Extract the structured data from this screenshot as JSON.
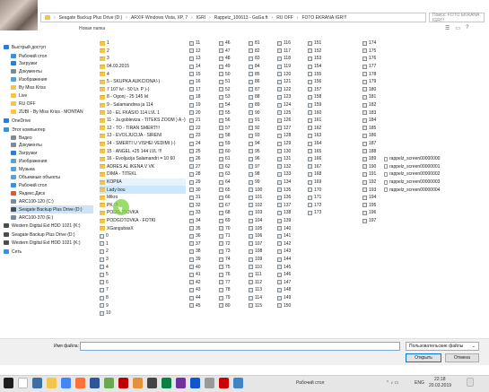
{
  "address": {
    "segments": [
      "Seagate Backup Plus Drive (D:)",
      "ARXIF Windows Vista, XP, 7",
      "IGRI",
      "Rappelz_100613 - GaGa ft",
      "RU OFF",
      "FOTO EKRANA IGR!!!"
    ]
  },
  "search": {
    "placeholder": "Поиск: FOTO EKRANA IGR!!!"
  },
  "toolbar": {
    "new_folder": "Новая папка"
  },
  "nav": [
    {
      "label": "Быстрый доступ",
      "icon": "star-icon",
      "color": "#2d7bd6"
    },
    {
      "label": "Рабочий стол",
      "icon": "desktop-icon",
      "color": "#3b8fdc"
    },
    {
      "label": "Загрузки",
      "icon": "download-icon",
      "color": "#2d7bd6"
    },
    {
      "label": "Документы",
      "icon": "document-icon",
      "color": "#7c8a99"
    },
    {
      "label": "Изображения",
      "icon": "image-icon",
      "color": "#5aa0d8"
    },
    {
      "label": "By Miss Kriss",
      "icon": "folder-icon",
      "color": "#f3c64b"
    },
    {
      "label": "Live",
      "icon": "folder-icon",
      "color": "#f3c64b"
    },
    {
      "label": "RU OFF",
      "icon": "folder-icon",
      "color": "#f3c64b"
    },
    {
      "label": "ZUBI - By Miss Kriss - MONTAN",
      "icon": "folder-icon",
      "color": "#f3c64b"
    },
    {
      "label": "OneDrive",
      "icon": "cloud-icon",
      "color": "#2d7bd6"
    },
    {
      "label": "Этот компьютер",
      "icon": "computer-icon",
      "color": "#3b8fdc"
    },
    {
      "label": "Видео",
      "icon": "video-icon",
      "color": "#7c8a99"
    },
    {
      "label": "Документы",
      "icon": "document-icon",
      "color": "#7c8a99"
    },
    {
      "label": "Загрузки",
      "icon": "download-icon",
      "color": "#2d7bd6"
    },
    {
      "label": "Изображения",
      "icon": "image-icon",
      "color": "#5aa0d8"
    },
    {
      "label": "Музыка",
      "icon": "music-icon",
      "color": "#5aa0d8"
    },
    {
      "label": "Объемные объекты",
      "icon": "cube-icon",
      "color": "#5aa0d8"
    },
    {
      "label": "Рабочий стол",
      "icon": "desktop-icon",
      "color": "#3b8fdc"
    },
    {
      "label": "Яндекс.Диск",
      "icon": "cloud-icon",
      "color": "#e05b2b"
    },
    {
      "label": "ARC100-120 (C:)",
      "icon": "drive-icon",
      "color": "#7c8a99"
    },
    {
      "label": "Seagate Backup Plus Drive (D:)",
      "icon": "drive-icon",
      "color": "#4c4c4c",
      "selected": true
    },
    {
      "label": "ARC100-370 (E:)",
      "icon": "drive-icon",
      "color": "#7c8a99"
    },
    {
      "label": "Western Digital Ext HDD 1021 (K:)",
      "icon": "drive-icon",
      "color": "#4c4c4c"
    },
    {
      "label": "Seagate Backup Plus Drive (D:)",
      "icon": "drive-icon",
      "color": "#4c4c4c"
    },
    {
      "label": "Western Digital Ext HDD 1021 (K:)",
      "icon": "drive-icon",
      "color": "#4c4c4c"
    },
    {
      "label": "Сеть",
      "icon": "network-icon",
      "color": "#3b8fdc"
    }
  ],
  "col1": [
    "1",
    "2",
    "3",
    "04.03.2015",
    "4",
    "5 - SKUPKA AUKCIONA!-)",
    "7 107 lvl - 50 Ur. P )-)",
    "8 - Ogonj - 25 145 lvl",
    "9 - Salamandrea ja 114",
    "10 - EL FKASIO 114 LVL 1",
    "11 - Ja gobleviza - TITEKS ZOOM ) A -)",
    "12 - TO - TIRAN SMERT!!!",
    "13 - EVOLJUCIJA - SIRENI",
    "14 - SMERTI U VISHEI VEDIMI )-)",
    "15 - ANGEL +25 144 LVL !!!",
    "16 - Evoljucija Salamandri = 10 60",
    "ADRES AL IKENA V VK",
    "DIMA - TITEKL",
    "KOPIIA",
    "Lady bou",
    "Mikro",
    "PK !!!",
    "PODGOTOVKA",
    "PODGOTOVKA - FOTKI",
    "XGangubasX",
    "0",
    "1",
    "2",
    "3",
    "4",
    "5",
    "6",
    "7",
    "8",
    "9",
    "10"
  ],
  "col2": [
    "11",
    "12",
    "13",
    "14",
    "15",
    "16",
    "17",
    "18",
    "19",
    "20",
    "21",
    "22",
    "23",
    "24",
    "25",
    "26",
    "27",
    "28",
    "29",
    "30",
    "31",
    "32",
    "33",
    "34",
    "35",
    "36",
    "37",
    "38",
    "39",
    "40",
    "41",
    "42",
    "43",
    "44",
    "45"
  ],
  "col3": [
    "46",
    "47",
    "48",
    "49",
    "50",
    "51",
    "52",
    "53",
    "54",
    "55",
    "56",
    "57",
    "58",
    "59",
    "60",
    "61",
    "62",
    "63",
    "64",
    "65",
    "66",
    "67",
    "68",
    "69",
    "70",
    "71",
    "72",
    "73",
    "74",
    "75",
    "76",
    "77",
    "78",
    "79",
    "80"
  ],
  "col4": [
    "81",
    "82",
    "83",
    "84",
    "85",
    "86",
    "87",
    "88",
    "89",
    "90",
    "91",
    "92",
    "93",
    "94",
    "95",
    "96",
    "97",
    "98",
    "99",
    "100",
    "101",
    "102",
    "103",
    "104",
    "105",
    "106",
    "107",
    "108",
    "109",
    "110",
    "111",
    "112",
    "113",
    "114",
    "115"
  ],
  "col5": [
    "116",
    "117",
    "118",
    "119",
    "120",
    "121",
    "122",
    "123",
    "124",
    "125",
    "126",
    "127",
    "128",
    "129",
    "130",
    "131",
    "132",
    "133",
    "134",
    "135",
    "136",
    "137",
    "138",
    "139",
    "140",
    "141",
    "142",
    "143",
    "144",
    "145",
    "146",
    "147",
    "148",
    "149",
    "150"
  ],
  "col6": [
    "151",
    "152",
    "153",
    "154",
    "155",
    "156",
    "157",
    "158",
    "159",
    "160",
    "161",
    "162",
    "163",
    "164",
    "165",
    "166",
    "167",
    "168",
    "169",
    "170",
    "171",
    "172",
    "173"
  ],
  "col7": [
    "174",
    "175",
    "176",
    "177",
    "178",
    "179",
    "180",
    "181",
    "182",
    "183",
    "184",
    "185",
    "186",
    "187",
    "188",
    "189",
    "190",
    "191",
    "192",
    "193",
    "194",
    "195",
    "196",
    "197"
  ],
  "col8": [
    "rappelz_screen00000000",
    "rappelz_screen00000001",
    "rappelz_screen00000002",
    "rappelz_screen00000003",
    "rappelz_screen00000004"
  ],
  "bottom": {
    "file_name_label": "Имя файла:",
    "file_name_value": "",
    "file_type": "Пользовательские файлы",
    "open_button": "Открыть",
    "cancel_button": "Отмена"
  },
  "taskbar": {
    "desktop_label": "Рабочий стол",
    "lang": "ENG",
    "time": "22:18",
    "date": "20.03.2019"
  }
}
